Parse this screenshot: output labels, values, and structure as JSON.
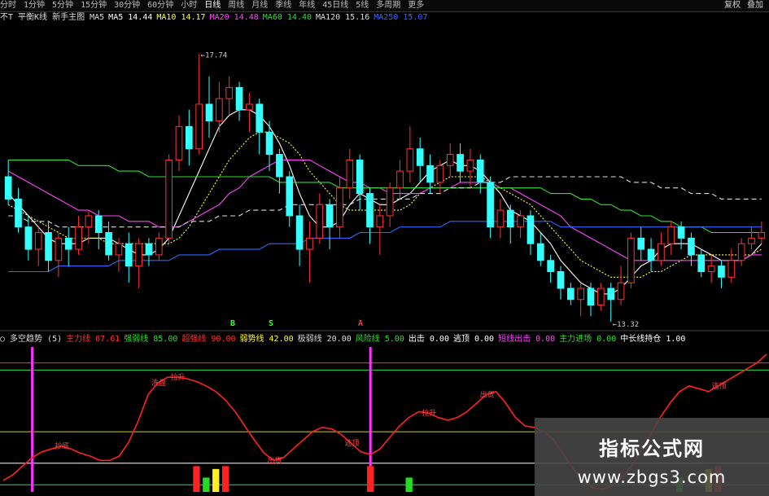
{
  "top_tabs": [
    "分时",
    "1分钟",
    "5分钟",
    "15分钟",
    "30分钟",
    "60分钟",
    "小时",
    "日线",
    "周线",
    "月线",
    "季线",
    "年线",
    "45日线",
    "5线",
    "多周期",
    "更多"
  ],
  "top_tab_active": "日线",
  "top_right_buttons": [
    "复权",
    "叠加"
  ],
  "ma_bar": [
    {
      "text": "不T 平衡K线 新手主图 MA5",
      "color": "#dddddd"
    },
    {
      "text": "MA5 14.44",
      "color": "#ffffff"
    },
    {
      "text": "MA10 14.17",
      "color": "#ffff33"
    },
    {
      "text": "MA20 14.48",
      "color": "#ff44ff"
    },
    {
      "text": "MA60 14.40",
      "color": "#33dd33"
    },
    {
      "text": "MA120 15.16",
      "color": "#dddddd"
    },
    {
      "text": "MA250 15.07",
      "color": "#3366ff"
    }
  ],
  "price_labels": {
    "high": "17.74",
    "low": "13.32"
  },
  "signal_marks": [
    {
      "text": "B",
      "color": "#33ff33"
    },
    {
      "text": "S",
      "color": "#33ff33"
    },
    {
      "text": "A",
      "color": "#ff3333"
    }
  ],
  "indicator_bar": [
    {
      "text": "○ 多空趋势 (5)",
      "color": "#dddddd"
    },
    {
      "text": "主力线 67.61",
      "color": "#ff3333"
    },
    {
      "text": "强弱线 85.00",
      "color": "#33dd33"
    },
    {
      "text": "超强线 90.00",
      "color": "#ff3333"
    },
    {
      "text": "弱势线 42.00",
      "color": "#ffff33"
    },
    {
      "text": "极弱线 20.00",
      "color": "#dddddd"
    },
    {
      "text": "风险线 5.00",
      "color": "#33dd33"
    },
    {
      "text": "出击 0.00",
      "color": "#ffffff"
    },
    {
      "text": "逃顶 0.00",
      "color": "#ffffff"
    },
    {
      "text": "短线出击 0.00",
      "color": "#ff44ff"
    },
    {
      "text": "主力进场 0.00",
      "color": "#33dd33"
    },
    {
      "text": "中长线持仓 1.00",
      "color": "#ffffff"
    }
  ],
  "indicator_annotations": [
    "抄底",
    "洗盘",
    "拉升",
    "出货",
    "逃顶",
    "拉升",
    "出货",
    "逃顶"
  ],
  "watermark": {
    "line1": "指标公式网",
    "line2": "www.zbgs3.com"
  },
  "colors": {
    "up": "#ff3333",
    "down": "#33ffff",
    "ma5": "#ffffff",
    "ma10": "#ffff33",
    "ma20": "#ff44ff",
    "ma60": "#33dd33",
    "ma120": "#dddddd",
    "ma250": "#3366ff",
    "osc": "#ff2222",
    "pink": "#ff33ff"
  },
  "chart_data": [
    {
      "type": "candlestick",
      "title": "",
      "ylim": [
        12.8,
        18.2
      ],
      "candles": [
        [
          15.5,
          15.1,
          15.8,
          15.0
        ],
        [
          15.1,
          14.6,
          15.3,
          14.5
        ],
        [
          14.6,
          14.2,
          14.8,
          14.0
        ],
        [
          14.2,
          14.5,
          14.6,
          13.9
        ],
        [
          14.5,
          14.0,
          14.7,
          13.8
        ],
        [
          14.0,
          14.4,
          14.5,
          13.7
        ],
        [
          14.4,
          14.2,
          14.6,
          13.9
        ],
        [
          14.2,
          14.6,
          14.8,
          14.1
        ],
        [
          14.6,
          14.8,
          14.9,
          14.3
        ],
        [
          14.8,
          14.5,
          14.9,
          14.2
        ],
        [
          14.5,
          14.1,
          14.7,
          14.0
        ],
        [
          14.1,
          14.3,
          14.4,
          13.8
        ],
        [
          14.3,
          13.9,
          14.5,
          13.6
        ],
        [
          13.9,
          14.3,
          14.4,
          13.5
        ],
        [
          14.3,
          14.1,
          14.4,
          13.9
        ],
        [
          14.1,
          14.4,
          14.5,
          14.0
        ],
        [
          14.4,
          15.8,
          15.9,
          14.3
        ],
        [
          15.8,
          16.4,
          16.6,
          15.6
        ],
        [
          16.4,
          16.0,
          16.7,
          15.7
        ],
        [
          16.0,
          16.8,
          17.7,
          15.9
        ],
        [
          16.8,
          16.5,
          17.3,
          16.2
        ],
        [
          16.5,
          16.9,
          17.2,
          16.3
        ],
        [
          16.9,
          17.1,
          17.3,
          16.6
        ],
        [
          17.1,
          16.7,
          17.2,
          16.5
        ],
        [
          16.7,
          16.8,
          17.0,
          16.3
        ],
        [
          16.8,
          16.3,
          16.9,
          15.9
        ],
        [
          16.3,
          15.9,
          16.5,
          15.6
        ],
        [
          15.9,
          15.5,
          16.0,
          15.2
        ],
        [
          15.5,
          14.8,
          15.6,
          14.6
        ],
        [
          14.8,
          14.2,
          15.0,
          13.9
        ],
        [
          14.2,
          14.4,
          14.7,
          13.6
        ],
        [
          14.4,
          15.0,
          15.2,
          14.3
        ],
        [
          15.0,
          14.6,
          15.1,
          14.2
        ],
        [
          14.6,
          15.3,
          15.5,
          14.4
        ],
        [
          15.3,
          15.8,
          16.0,
          15.1
        ],
        [
          15.8,
          15.2,
          15.9,
          14.9
        ],
        [
          15.2,
          14.6,
          15.3,
          14.3
        ],
        [
          14.6,
          14.8,
          15.0,
          14.1
        ],
        [
          14.8,
          15.3,
          15.4,
          14.6
        ],
        [
          15.3,
          15.6,
          15.8,
          15.1
        ],
        [
          15.6,
          16.0,
          16.4,
          15.4
        ],
        [
          16.0,
          15.7,
          16.2,
          15.4
        ],
        [
          15.7,
          15.4,
          15.9,
          15.2
        ],
        [
          15.4,
          15.7,
          15.8,
          15.2
        ],
        [
          15.7,
          15.9,
          16.1,
          15.5
        ],
        [
          15.9,
          15.6,
          16.1,
          15.4
        ],
        [
          15.6,
          15.8,
          16.0,
          15.3
        ],
        [
          15.8,
          15.4,
          15.9,
          15.2
        ],
        [
          15.4,
          14.6,
          15.5,
          14.4
        ],
        [
          14.6,
          14.9,
          15.1,
          14.4
        ],
        [
          14.9,
          14.6,
          15.0,
          14.3
        ],
        [
          14.6,
          14.8,
          14.9,
          14.4
        ],
        [
          14.8,
          14.3,
          14.9,
          14.1
        ],
        [
          14.3,
          14.0,
          14.5,
          13.9
        ],
        [
          14.0,
          13.8,
          14.1,
          13.6
        ],
        [
          13.8,
          13.5,
          13.9,
          13.3
        ],
        [
          13.5,
          13.3,
          13.6,
          13.2
        ],
        [
          13.3,
          13.5,
          13.6,
          13.0
        ],
        [
          13.5,
          13.2,
          13.6,
          13.0
        ],
        [
          13.2,
          13.5,
          13.6,
          13.1
        ],
        [
          13.5,
          13.3,
          13.6,
          12.9
        ],
        [
          13.3,
          13.6,
          13.9,
          13.2
        ],
        [
          13.6,
          14.4,
          14.5,
          13.5
        ],
        [
          14.4,
          14.2,
          14.6,
          14.0
        ],
        [
          14.2,
          14.0,
          14.4,
          13.8
        ],
        [
          14.0,
          14.3,
          14.5,
          13.9
        ],
        [
          14.3,
          14.6,
          14.7,
          14.1
        ],
        [
          14.6,
          14.4,
          14.7,
          14.2
        ],
        [
          14.4,
          14.1,
          14.5,
          13.9
        ],
        [
          14.1,
          13.8,
          14.2,
          13.7
        ],
        [
          13.8,
          13.9,
          14.1,
          13.6
        ],
        [
          13.9,
          13.7,
          14.0,
          13.5
        ],
        [
          13.7,
          14.0,
          14.2,
          13.6
        ],
        [
          14.0,
          14.3,
          14.4,
          13.9
        ],
        [
          14.3,
          14.4,
          14.6,
          14.2
        ],
        [
          14.4,
          14.5,
          14.7,
          14.3
        ]
      ],
      "series": [
        {
          "name": "MA5",
          "values": [
            15.2,
            15.0,
            14.8,
            14.6,
            14.4,
            14.3,
            14.3,
            14.3,
            14.4,
            14.4,
            14.4,
            14.3,
            14.2,
            14.1,
            14.1,
            14.2,
            14.4,
            14.8,
            15.2,
            15.6,
            16.0,
            16.4,
            16.6,
            16.7,
            16.7,
            16.6,
            16.4,
            16.1,
            15.7,
            15.2,
            14.8,
            14.6,
            14.6,
            14.7,
            15.0,
            15.2,
            15.1,
            15.0,
            15.0,
            15.1,
            15.2,
            15.4,
            15.6,
            15.7,
            15.8,
            15.7,
            15.7,
            15.6,
            15.4,
            15.2,
            14.9,
            14.8,
            14.7,
            14.5,
            14.3,
            14.0,
            13.8,
            13.6,
            13.5,
            13.4,
            13.4,
            13.5,
            13.7,
            13.9,
            14.0,
            14.2,
            14.3,
            14.3,
            14.3,
            14.2,
            14.1,
            14.0,
            14.0,
            14.0,
            14.1,
            14.3
          ]
        },
        {
          "name": "MA10",
          "values": [
            15.0,
            14.9,
            14.8,
            14.7,
            14.6,
            14.5,
            14.4,
            14.4,
            14.4,
            14.4,
            14.3,
            14.3,
            14.3,
            14.3,
            14.3,
            14.3,
            14.3,
            14.4,
            14.6,
            14.9,
            15.2,
            15.5,
            15.8,
            16.0,
            16.2,
            16.3,
            16.3,
            16.2,
            16.1,
            15.9,
            15.6,
            15.4,
            15.2,
            15.0,
            14.9,
            14.9,
            14.9,
            14.9,
            14.9,
            14.9,
            15.0,
            15.2,
            15.3,
            15.4,
            15.5,
            15.5,
            15.5,
            15.5,
            15.4,
            15.3,
            15.2,
            15.1,
            15.0,
            14.8,
            14.6,
            14.4,
            14.2,
            14.0,
            13.9,
            13.8,
            13.7,
            13.7,
            13.7,
            13.7,
            13.8,
            13.8,
            13.9,
            14.0,
            14.1,
            14.1,
            14.1,
            14.1,
            14.1,
            14.1,
            14.1,
            14.2
          ]
        },
        {
          "name": "MA20",
          "values": [
            15.6,
            15.5,
            15.4,
            15.3,
            15.2,
            15.1,
            15.0,
            14.9,
            14.9,
            14.8,
            14.8,
            14.8,
            14.7,
            14.7,
            14.7,
            14.6,
            14.6,
            14.6,
            14.7,
            14.8,
            14.9,
            15.0,
            15.2,
            15.3,
            15.5,
            15.6,
            15.7,
            15.8,
            15.8,
            15.8,
            15.8,
            15.7,
            15.6,
            15.5,
            15.4,
            15.4,
            15.3,
            15.3,
            15.2,
            15.2,
            15.2,
            15.2,
            15.3,
            15.3,
            15.3,
            15.4,
            15.4,
            15.4,
            15.4,
            15.3,
            15.3,
            15.2,
            15.1,
            15.0,
            14.9,
            14.8,
            14.6,
            14.5,
            14.4,
            14.3,
            14.2,
            14.1,
            14.0,
            14.0,
            14.0,
            14.0,
            14.0,
            14.0,
            14.0,
            14.0,
            14.0,
            14.0,
            14.0,
            14.0,
            14.1,
            14.1
          ]
        },
        {
          "name": "MA60",
          "values": [
            15.8,
            15.8,
            15.8,
            15.8,
            15.8,
            15.8,
            15.8,
            15.7,
            15.7,
            15.7,
            15.7,
            15.6,
            15.6,
            15.6,
            15.5,
            15.5,
            15.5,
            15.5,
            15.5,
            15.5,
            15.5,
            15.5,
            15.5,
            15.5,
            15.5,
            15.5,
            15.5,
            15.4,
            15.4,
            15.4,
            15.4,
            15.4,
            15.4,
            15.3,
            15.3,
            15.3,
            15.3,
            15.3,
            15.3,
            15.3,
            15.3,
            15.3,
            15.3,
            15.3,
            15.3,
            15.3,
            15.3,
            15.3,
            15.3,
            15.3,
            15.3,
            15.3,
            15.3,
            15.3,
            15.2,
            15.2,
            15.2,
            15.1,
            15.1,
            15.0,
            15.0,
            14.9,
            14.9,
            14.8,
            14.8,
            14.7,
            14.7,
            14.6,
            14.6,
            14.6,
            14.5,
            14.5,
            14.5,
            14.5,
            14.5,
            14.5
          ]
        },
        {
          "name": "MA120",
          "values": [
            14.8,
            14.8,
            14.7,
            14.7,
            14.7,
            14.6,
            14.6,
            14.6,
            14.6,
            14.6,
            14.6,
            14.6,
            14.6,
            14.6,
            14.6,
            14.6,
            14.6,
            14.6,
            14.7,
            14.7,
            14.7,
            14.8,
            14.8,
            14.8,
            14.9,
            14.9,
            14.9,
            14.9,
            15.0,
            15.0,
            15.0,
            15.0,
            15.0,
            15.0,
            15.0,
            15.1,
            15.1,
            15.1,
            15.1,
            15.1,
            15.1,
            15.2,
            15.2,
            15.2,
            15.3,
            15.3,
            15.3,
            15.4,
            15.4,
            15.4,
            15.5,
            15.5,
            15.5,
            15.5,
            15.5,
            15.5,
            15.5,
            15.5,
            15.5,
            15.5,
            15.5,
            15.5,
            15.4,
            15.4,
            15.4,
            15.3,
            15.3,
            15.3,
            15.2,
            15.2,
            15.2,
            15.1,
            15.1,
            15.1,
            15.1,
            15.1
          ]
        },
        {
          "name": "MA250",
          "values": [
            13.8,
            13.8,
            13.8,
            13.8,
            13.8,
            13.9,
            13.9,
            13.9,
            13.9,
            13.9,
            13.9,
            14.0,
            14.0,
            14.0,
            14.0,
            14.0,
            14.0,
            14.1,
            14.1,
            14.1,
            14.1,
            14.2,
            14.2,
            14.2,
            14.2,
            14.2,
            14.3,
            14.3,
            14.3,
            14.3,
            14.4,
            14.4,
            14.4,
            14.4,
            14.4,
            14.5,
            14.5,
            14.5,
            14.5,
            14.6,
            14.6,
            14.6,
            14.6,
            14.6,
            14.7,
            14.7,
            14.7,
            14.7,
            14.7,
            14.7,
            14.7,
            14.7,
            14.7,
            14.7,
            14.7,
            14.6,
            14.6,
            14.6,
            14.6,
            14.6,
            14.6,
            14.6,
            14.6,
            14.6,
            14.6,
            14.6,
            14.6,
            14.6,
            14.6,
            14.6,
            14.6,
            14.6,
            14.6,
            14.6,
            14.6,
            14.6
          ]
        }
      ]
    },
    {
      "type": "line",
      "title": "",
      "ylim": [
        0,
        100
      ],
      "hlines": [
        90,
        85,
        42,
        20,
        5
      ],
      "series": [
        {
          "name": "主力线",
          "values": [
            8,
            12,
            18,
            24,
            28,
            30,
            32,
            30,
            27,
            25,
            22,
            22,
            25,
            35,
            50,
            68,
            76,
            80,
            80,
            79,
            77,
            74,
            70,
            64,
            56,
            46,
            36,
            27,
            22,
            24,
            30,
            36,
            42,
            45,
            44,
            40,
            34,
            28,
            26,
            30,
            38,
            46,
            52,
            56,
            55,
            52,
            50,
            52,
            56,
            62,
            68,
            70,
            62,
            52,
            46,
            45,
            42,
            36,
            26,
            16,
            8,
            3,
            2,
            4,
            10,
            18,
            28,
            40,
            52,
            62,
            70,
            74,
            72,
            70,
            74,
            78,
            82,
            86,
            90,
            96
          ]
        }
      ],
      "bars": {
        "pink_spikes": [
          3,
          38
        ],
        "red": [
          20,
          23,
          38,
          74
        ],
        "green": [
          21,
          42,
          70
        ],
        "yellow": [
          22,
          73
        ]
      }
    }
  ]
}
